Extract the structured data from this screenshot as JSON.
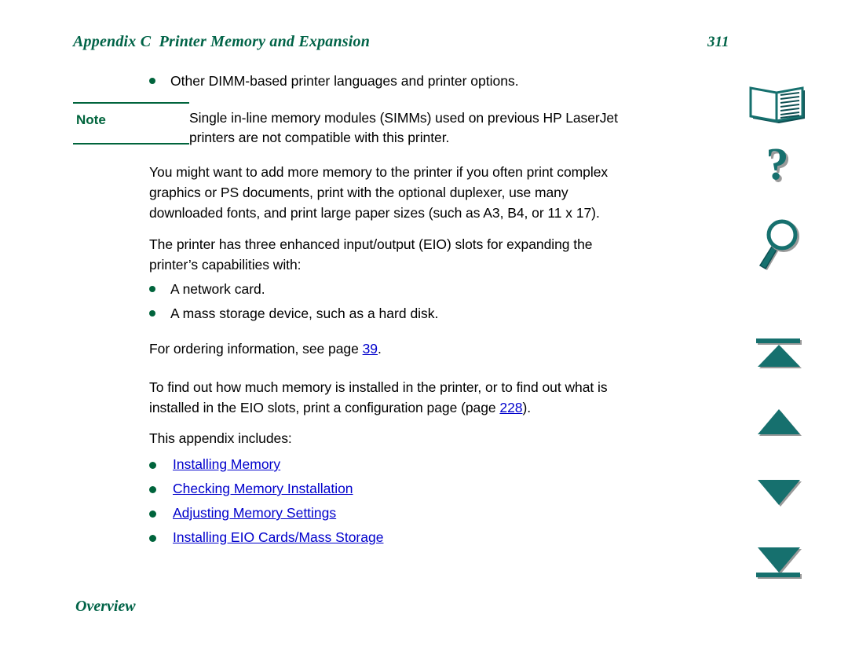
{
  "document": {
    "header_title": "Appendix C  Printer Memory and Expansion",
    "page_number": "311",
    "section_heading": "Overview"
  },
  "content": {
    "top_bullet": "Other DIMM-based printer languages and printer options.",
    "note": {
      "label": "Note",
      "line1": "Single in-line memory modules (SIMMs) used on previous HP LaserJet",
      "line2": "printers are not compatible with this printer."
    },
    "paragraph_memory": {
      "line1": "You might want to add more memory to the printer if you often print complex",
      "line2": "graphics or PS documents, print with the optional duplexer, use many",
      "line3": "downloaded fonts, and print large paper sizes (such as A3, B4, or 11 x 17)."
    },
    "paragraph_eio": {
      "line1": "The printer has three enhanced input/output (EIO) slots for expanding the",
      "line2": "printer’s capabilities with:"
    },
    "eio_bullets": [
      "A network card.",
      "A mass storage device, such as a hard disk."
    ],
    "ordering": {
      "prefix": "For ordering information, see page ",
      "link": "39",
      "suffix": "."
    },
    "paragraph_config": {
      "line1": "To find out how much memory is installed in the printer, or to find out what is",
      "line2_prefix": "installed in the EIO slots, print a configuration page (page ",
      "line2_link": "228",
      "line2_suffix": ")."
    },
    "includes_intro": "This appendix includes:",
    "includes_links": [
      "Installing Memory",
      "Checking Memory Installation",
      "Adjusting Memory Settings",
      "Installing EIO Cards/Mass Storage"
    ]
  },
  "nav_rail": {
    "book": "book-icon",
    "help": "question-mark-icon",
    "search": "magnifier-icon",
    "first": "go-to-first-page-icon",
    "prev": "previous-page-icon",
    "next": "next-page-icon",
    "last": "go-to-last-page-icon"
  },
  "colors": {
    "heading_green": "#006347",
    "bullet_green": "#00643c",
    "link_blue": "#0000cc",
    "icon_teal": "#16706e",
    "icon_teal_dark": "#0d4f52",
    "icon_shadow": "#9a9a9a",
    "page_bg": "#ffffff",
    "text": "#000000"
  }
}
